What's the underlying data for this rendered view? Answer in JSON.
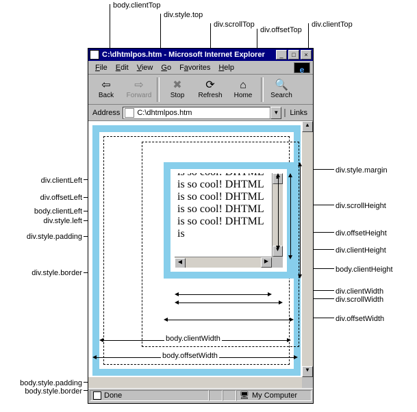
{
  "browser": {
    "title": "C:\\dhtmlpos.htm - Microsoft Internet Explorer",
    "menu": [
      "File",
      "Edit",
      "View",
      "Go",
      "Favorites",
      "Help"
    ],
    "toolbar": {
      "back": "Back",
      "forward": "Forward",
      "stop": "Stop",
      "refresh": "Refresh",
      "home": "Home",
      "search": "Search"
    },
    "address_label": "Address",
    "address_value": "C:\\dhtmlpos.htm",
    "links_label": "Links",
    "status_done": "Done",
    "status_zone": "My Computer"
  },
  "inner_text": "is so cool! DHTML is so cool! DHTML is so cool! DHTML is so cool! DHTML is so cool! DHTML is",
  "callouts": {
    "top": {
      "body_clientTop": "body.clientTop",
      "div_style_top": "div.style.top",
      "div_scrollTop": "div.scrollTop",
      "div_offsetTop": "div.offsetTop",
      "div_clientTop": "div.clientTop"
    },
    "left": {
      "div_clientLeft": "div.clientLeft",
      "div_offsetLeft": "div.offsetLeft",
      "body_clientLeft": "body.clientLeft",
      "div_style_left": "div.style.left",
      "div_style_padding": "div.style.padding",
      "div_style_border": "div.style.border",
      "body_style_padding": "body.style.padding",
      "body_style_border": "body.style.border"
    },
    "right": {
      "div_style_margin": "div.style.margin",
      "div_scrollHeight": "div.scrollHeight",
      "div_offsetHeight": "div.offsetHeight",
      "div_clientHeight": "div.clientHeight",
      "body_clientHeight": "body.clientHeight",
      "div_clientWidth": "div.clientWidth",
      "div_scrollWidth": "div.scrollWidth",
      "div_offsetWidth": "div.offsetWidth"
    },
    "bottom": {
      "body_clientWidth": "body.clientWidth",
      "body_offsetWidth": "body.offsetWidth"
    }
  }
}
